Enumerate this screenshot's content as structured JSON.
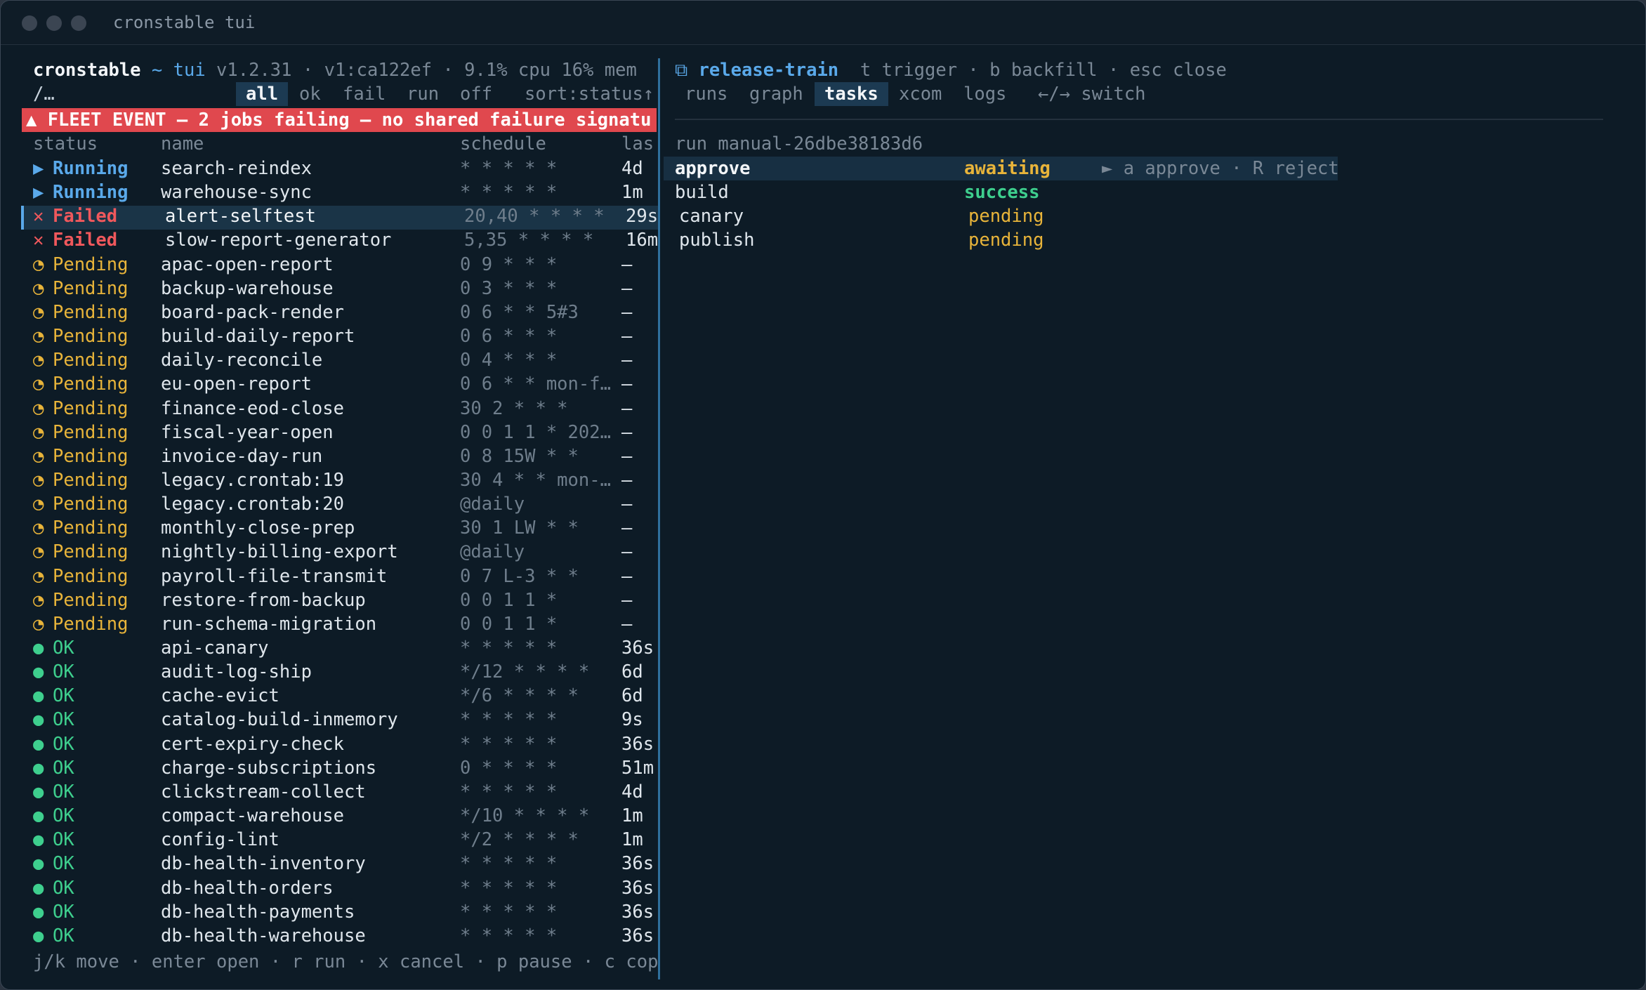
{
  "window": {
    "title": "cronstable tui"
  },
  "header": {
    "app": "cronstable",
    "sep": "~",
    "mode": "tui",
    "version": "v1.2.31",
    "build": "v1:ca122ef",
    "cpu": "9.1% cpu",
    "mem": "16% mem"
  },
  "filter": {
    "prompt": "/…",
    "tabs": [
      "all",
      "ok",
      "fail",
      "run",
      "off"
    ],
    "active_tab": "all",
    "sort": "sort:status↑"
  },
  "banner": {
    "text": "▲ FLEET EVENT — 2 jobs failing — no shared failure signatu"
  },
  "table": {
    "headers": {
      "status": "status",
      "name": "name",
      "schedule": "schedule",
      "last": "las"
    },
    "rows": [
      {
        "status": "Running",
        "icon": "▶",
        "name": "search-reindex",
        "schedule": "* * * * *",
        "last": "4d"
      },
      {
        "status": "Running",
        "icon": "▶",
        "name": "warehouse-sync",
        "schedule": "* * * * *",
        "last": "1m"
      },
      {
        "status": "Failed",
        "icon": "✕",
        "name": "alert-selftest",
        "schedule": "20,40 * * * *",
        "last": "29s"
      },
      {
        "status": "Failed",
        "icon": "✕",
        "name": "slow-report-generator",
        "schedule": "5,35 * * * *",
        "last": "16m"
      },
      {
        "status": "Pending",
        "icon": "◔",
        "name": "apac-open-report",
        "schedule": "0 9 * * *",
        "last": "—"
      },
      {
        "status": "Pending",
        "icon": "◔",
        "name": "backup-warehouse",
        "schedule": "0 3 * * *",
        "last": "—"
      },
      {
        "status": "Pending",
        "icon": "◔",
        "name": "board-pack-render",
        "schedule": "0 6 * * 5#3",
        "last": "—"
      },
      {
        "status": "Pending",
        "icon": "◔",
        "name": "build-daily-report",
        "schedule": "0 6 * * *",
        "last": "—"
      },
      {
        "status": "Pending",
        "icon": "◔",
        "name": "daily-reconcile",
        "schedule": "0 4 * * *",
        "last": "—"
      },
      {
        "status": "Pending",
        "icon": "◔",
        "name": "eu-open-report",
        "schedule": "0 6 * * mon-f…",
        "last": "—"
      },
      {
        "status": "Pending",
        "icon": "◔",
        "name": "finance-eod-close",
        "schedule": "30 2 * * *",
        "last": "—"
      },
      {
        "status": "Pending",
        "icon": "◔",
        "name": "fiscal-year-open",
        "schedule": "0 0 1 1 * 202…",
        "last": "—"
      },
      {
        "status": "Pending",
        "icon": "◔",
        "name": "invoice-day-run",
        "schedule": "0 8 15W * *",
        "last": "—"
      },
      {
        "status": "Pending",
        "icon": "◔",
        "name": "legacy.crontab:19",
        "schedule": "30 4 * * mon-…",
        "last": "—"
      },
      {
        "status": "Pending",
        "icon": "◔",
        "name": "legacy.crontab:20",
        "schedule": "@daily",
        "last": "—"
      },
      {
        "status": "Pending",
        "icon": "◔",
        "name": "monthly-close-prep",
        "schedule": "30 1 LW * *",
        "last": "—"
      },
      {
        "status": "Pending",
        "icon": "◔",
        "name": "nightly-billing-export",
        "schedule": "@daily",
        "last": "—"
      },
      {
        "status": "Pending",
        "icon": "◔",
        "name": "payroll-file-transmit",
        "schedule": "0 7 L-3 * *",
        "last": "—"
      },
      {
        "status": "Pending",
        "icon": "◔",
        "name": "restore-from-backup",
        "schedule": "0 0 1 1 *",
        "last": "—"
      },
      {
        "status": "Pending",
        "icon": "◔",
        "name": "run-schema-migration",
        "schedule": "0 0 1 1 *",
        "last": "—"
      },
      {
        "status": "OK",
        "icon": "●",
        "name": "api-canary",
        "schedule": "* * * * *",
        "last": "36s"
      },
      {
        "status": "OK",
        "icon": "●",
        "name": "audit-log-ship",
        "schedule": "*/12 * * * *",
        "last": "6d"
      },
      {
        "status": "OK",
        "icon": "●",
        "name": "cache-evict",
        "schedule": "*/6 * * * *",
        "last": "6d"
      },
      {
        "status": "OK",
        "icon": "●",
        "name": "catalog-build-inmemory",
        "schedule": "* * * * *",
        "last": "9s"
      },
      {
        "status": "OK",
        "icon": "●",
        "name": "cert-expiry-check",
        "schedule": "* * * * *",
        "last": "36s"
      },
      {
        "status": "OK",
        "icon": "●",
        "name": "charge-subscriptions",
        "schedule": "0 * * * *",
        "last": "51m"
      },
      {
        "status": "OK",
        "icon": "●",
        "name": "clickstream-collect",
        "schedule": "* * * * *",
        "last": "4d"
      },
      {
        "status": "OK",
        "icon": "●",
        "name": "compact-warehouse",
        "schedule": "*/10 * * * *",
        "last": "1m"
      },
      {
        "status": "OK",
        "icon": "●",
        "name": "config-lint",
        "schedule": "*/2 * * * *",
        "last": "1m"
      },
      {
        "status": "OK",
        "icon": "●",
        "name": "db-health-inventory",
        "schedule": "* * * * *",
        "last": "36s"
      },
      {
        "status": "OK",
        "icon": "●",
        "name": "db-health-orders",
        "schedule": "* * * * *",
        "last": "36s"
      },
      {
        "status": "OK",
        "icon": "●",
        "name": "db-health-payments",
        "schedule": "* * * * *",
        "last": "36s"
      },
      {
        "status": "OK",
        "icon": "●",
        "name": "db-health-warehouse",
        "schedule": "* * * * *",
        "last": "36s"
      }
    ],
    "selected_row": 2
  },
  "footer": {
    "hints": "j/k move · enter open · r run · x cancel · p pause · c cop"
  },
  "detail": {
    "icon": "⧉",
    "job": "release-train",
    "keys": "t trigger · b backfill · esc close",
    "tabs": [
      "runs",
      "graph",
      "tasks",
      "xcom",
      "logs"
    ],
    "active_tab": "tasks",
    "switch_hint": "←/→ switch",
    "run_label": "run manual-26dbe38183d6",
    "tasks": [
      {
        "name": "approve",
        "state": "awaiting",
        "hint": "► a approve · R reject"
      },
      {
        "name": "build",
        "state": "success",
        "hint": ""
      },
      {
        "name": "canary",
        "state": "pending",
        "hint": ""
      },
      {
        "name": "publish",
        "state": "pending",
        "hint": ""
      }
    ]
  },
  "colors": {
    "background": "#0d1b26",
    "running": "#5aa9ea",
    "failed": "#f0585c",
    "pending": "#e8b43a",
    "ok": "#3ecf8e",
    "banner": "#e0484e"
  }
}
